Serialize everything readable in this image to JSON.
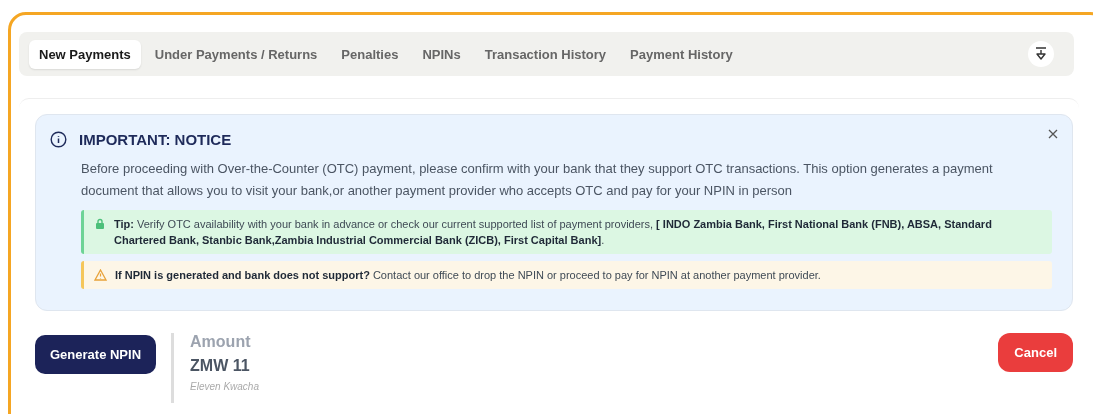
{
  "tabs": [
    {
      "label": "New Payments",
      "selected": true
    },
    {
      "label": "Under Payments / Returns",
      "selected": false
    },
    {
      "label": "Penalties",
      "selected": false
    },
    {
      "label": "NPINs",
      "selected": false
    },
    {
      "label": "Transaction History",
      "selected": false
    },
    {
      "label": "Payment History",
      "selected": false
    }
  ],
  "notice": {
    "title": "IMPORTANT: NOTICE",
    "body": "Before proceeding with Over-the-Counter (OTC) payment, please confirm with your bank that they support OTC transactions. This option generates a payment document that allows you to visit your bank,or another payment provider who accepts OTC and pay for your NPIN in person",
    "callouts": [
      {
        "kind": "tip",
        "text": "**Tip:** Verify OTC availability with your bank in advance or check our current supported list of payment providers, **[ INDO Zambia Bank, First National Bank (FNB), ABSA, Standard Chartered Bank, Stanbic Bank,Zambia Industrial Commercial Bank (ZICB), First Capital Bank]**."
      },
      {
        "kind": "warning",
        "text": "**If NPIN is generated and bank does not support?** Contact our office to drop the NPIN or proceed to pay for NPIN at another payment provider."
      }
    ]
  },
  "generate_button": "Generate NPIN",
  "amount": {
    "label": "Amount",
    "value": "ZMW 11",
    "words": "Eleven Kwacha"
  },
  "cancel_button": "Cancel"
}
